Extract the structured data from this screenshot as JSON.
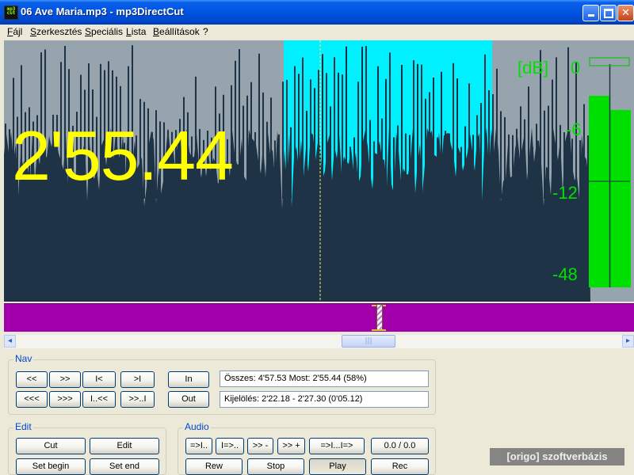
{
  "window": {
    "title": "06 Ave Maria.mp3 - mp3DirectCut",
    "icon": "mp3-cut-app-icon",
    "icon_text": "mp3 cut"
  },
  "menu": [
    "Fájl",
    "Szerkesztés",
    "Speciális",
    "Lista",
    "Beállítások",
    "?"
  ],
  "waveform": {
    "time_display": "2'55.44",
    "db_unit": "[dB]",
    "db_scale": [
      "0",
      "-6",
      "-12",
      "-48"
    ],
    "colors": {
      "background": "#98a4ad",
      "wave": "#1e3446",
      "selection": "#00f0ff",
      "time_text": "#ffff00",
      "meter": "#00e000"
    }
  },
  "overview": {
    "color": "#a300ad"
  },
  "nav": {
    "label": "Nav",
    "buttons_row1": [
      "<<",
      ">>",
      "I<",
      ">I"
    ],
    "buttons_row2": [
      "<<<",
      ">>>",
      "I..<<",
      ">>..I"
    ],
    "in_label": "In",
    "out_label": "Out",
    "total_info": "Összes: 4'57.53   Most: 2'55.44   (58%)",
    "selection_info": "Kijelölés: 2'22.18 - 2'27.30 (0'05.12)"
  },
  "edit": {
    "label": "Edit",
    "buttons": [
      "Cut",
      "Edit",
      "Set begin",
      "Set end"
    ]
  },
  "audio": {
    "label": "Audio",
    "buttons_row1": [
      "=>I..",
      "I=>..",
      ">> -",
      ">> +",
      "=>I...I=>",
      "0.0 / 0.0"
    ],
    "buttons_row2": [
      "Rew",
      "Stop",
      "Play",
      "Rec"
    ]
  },
  "watermark": "[origo] szoftverbázis"
}
